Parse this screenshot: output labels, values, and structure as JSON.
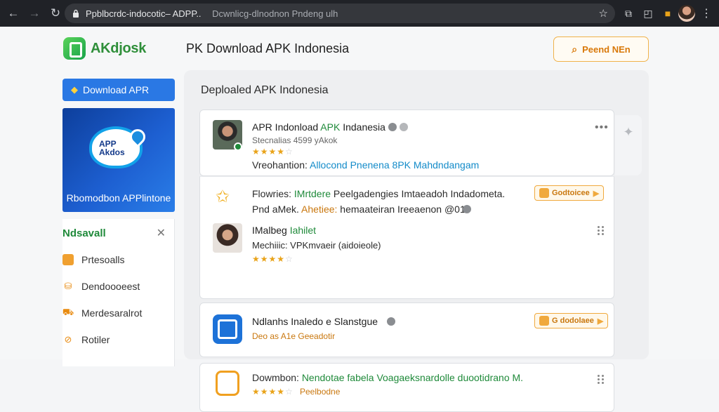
{
  "browser": {
    "url_main": "Ppblbcrdc-indocotic–",
    "url_tail": "ADPP..",
    "url_title": "Dcwnlicg-dlnodnon Pndeng ulh"
  },
  "header": {
    "logo_text": "AKdjosk",
    "page_title": "PK Download APK Indonesia",
    "search_label": "Peend NEn"
  },
  "sidebar": {
    "download_button": "Download APR",
    "promo_bubble_line1": "APP",
    "promo_bubble_line2": "Akdos",
    "promo_caption": "Rbomodbon APPlintone",
    "section_title": "Ndsavall",
    "items": [
      {
        "label": "Prtesoalls"
      },
      {
        "label": "Dendoooeest"
      },
      {
        "label": "Merdesaralrot"
      },
      {
        "label": "Rotiler"
      }
    ]
  },
  "main": {
    "heading": "Deploaled APK Indonesia",
    "featured": {
      "name_pre": "APR Indonload ",
      "name_green": "APK",
      "name_post": " Indanesia",
      "subtitle": "Stecnalias 4599 yAkok",
      "rating_stars": "★★★★",
      "rating_off": "☆",
      "desc_pre": "Vreohantion: ",
      "desc_blue": "Allocond Pnenena 8PK Mahdndangam"
    },
    "row1": {
      "line1_pre": "Flowries: ",
      "line1_green": "IMrtdere",
      "line1_post": " Peelgadengies Imtaeadoh Indadometa.",
      "line2_pre": "Pnd aMek. ",
      "line2_orange": "Ahetiee:",
      "line2_post": " hemaateiran Ireeaenon @01",
      "button": "Godtoicee"
    },
    "row2": {
      "name_pre": "IMalbeg ",
      "name_green": "Iahilet",
      "subtitle": "Mechiiic: VPKmvaeir (aidoieole)",
      "rating_stars": "★★★★",
      "rating_off": "☆"
    },
    "row3": {
      "name": "Ndlanhs Inaledo e Slanstgue",
      "subtitle_orange": "Deo as A1e Geeadotir",
      "button": "G dodolaee"
    },
    "row4": {
      "line1_pre": "Dowmbon: ",
      "line1_green": "Nendotae fabela Voagaeksnardolle duootidrano M.",
      "rating_stars": "★★★★",
      "rating_off": "☆",
      "rating_label": "Peelbodne"
    }
  },
  "colors": {
    "accent_green": "#1f8a3a",
    "accent_blue": "#2a78e4",
    "accent_orange": "#f0a93d"
  }
}
